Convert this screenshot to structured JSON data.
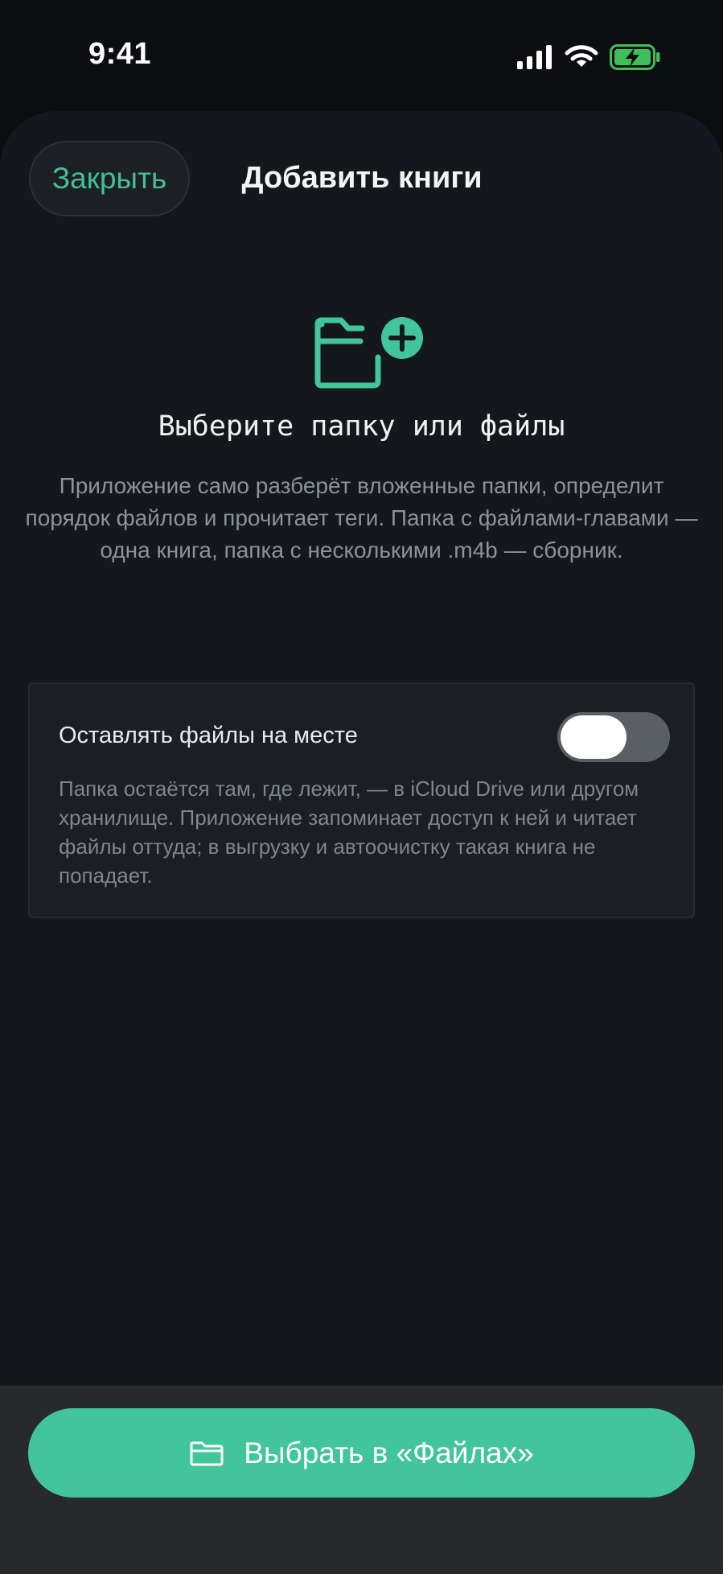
{
  "status_bar": {
    "time": "9:41",
    "icons": [
      "cellular-signal-icon",
      "wifi-icon",
      "battery-charging-icon"
    ]
  },
  "sheet": {
    "close_label": "Закрыть",
    "title": "Добавить книги"
  },
  "hero": {
    "icon": "folder-plus-icon",
    "title": "Выберите папку или файлы",
    "description": "Приложение само разберёт вложенные папки, определит порядок файлов и прочитает теги. Папка с файлами-главами — одна книга, папка с несколькими .m4b — сборник."
  },
  "keep_in_place": {
    "label": "Оставлять файлы на месте",
    "enabled": false,
    "description": "Папка остаётся там, где лежит, — в iCloud Drive или другом хранилище. Приложение запоминает доступ к ней и читает файлы оттуда; в выгрузку и автоочистку такая книга не попадает."
  },
  "primary_action": {
    "icon": "folder-icon",
    "label": "Выбрать в «Файлах»"
  },
  "colors": {
    "accent": "#43c59b",
    "background": "#14171b",
    "battery": "#3fbf5a"
  }
}
